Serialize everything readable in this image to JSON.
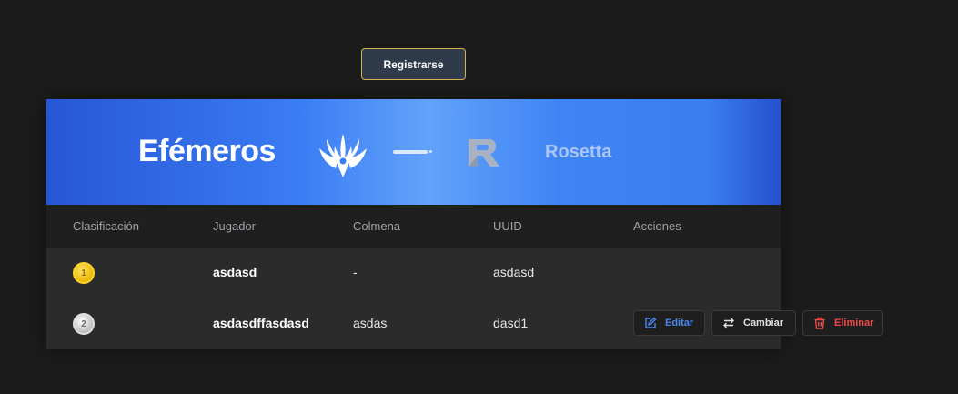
{
  "header": {
    "register_label": "Registrarse"
  },
  "match": {
    "team_name": "Efémeros",
    "opponent_name": "Rosetta"
  },
  "table": {
    "columns": [
      "Clasificación",
      "Jugador",
      "Colmena",
      "UUID",
      "Acciones"
    ],
    "rows": [
      {
        "rank": "1",
        "player": "asdasd",
        "hive": "-",
        "uuid": "asdasd"
      },
      {
        "rank": "2",
        "player": "asdasdffasdasd",
        "hive": "asdas",
        "uuid": "dasd1"
      }
    ]
  },
  "actions": {
    "edit_label": "Editar",
    "swap_label": "Cambiar",
    "delete_label": "Eliminar"
  },
  "colors": {
    "edit": "#4a86f0",
    "swap": "#e0e0e0",
    "delete": "#ef4a4a",
    "gold": "#ffd12e",
    "silver": "#e0e0e0"
  }
}
